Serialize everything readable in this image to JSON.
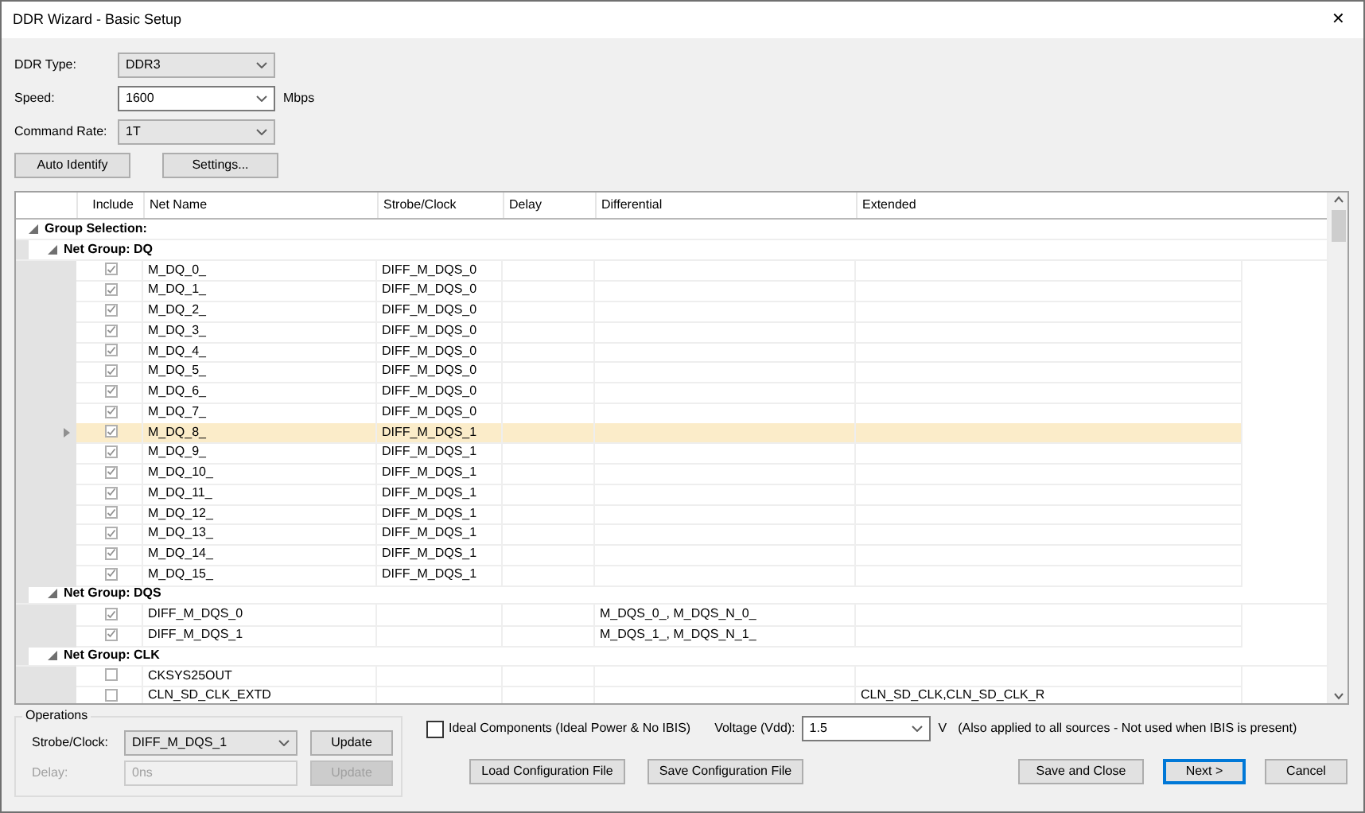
{
  "window": {
    "title": "DDR Wizard - Basic Setup",
    "close": "✕"
  },
  "fields": [
    {
      "label": "DDR Type:",
      "value": "DDR3",
      "editable": false
    },
    {
      "label": "Speed:",
      "value": "1600",
      "unit": "Mbps",
      "editable": true
    },
    {
      "label": "Command Rate:",
      "value": "1T",
      "editable": false
    }
  ],
  "buttons": [
    "Auto Identify",
    "Settings..."
  ],
  "grid": {
    "columns": [
      "Include",
      "Net Name",
      "Strobe/Clock",
      "Delay",
      "Differential",
      "Extended"
    ],
    "root": {
      "label": "Group Selection:",
      "expanded": true,
      "children": [
        {
          "label": "Net Group: DQ",
          "expanded": true,
          "rows": [
            {
              "include": true,
              "net": "M_DQ_0_",
              "strobe": "DIFF_M_DQS_0",
              "selected": false
            },
            {
              "include": true,
              "net": "M_DQ_1_",
              "strobe": "DIFF_M_DQS_0",
              "selected": false
            },
            {
              "include": true,
              "net": "M_DQ_2_",
              "strobe": "DIFF_M_DQS_0",
              "selected": false
            },
            {
              "include": true,
              "net": "M_DQ_3_",
              "strobe": "DIFF_M_DQS_0",
              "selected": false
            },
            {
              "include": true,
              "net": "M_DQ_4_",
              "strobe": "DIFF_M_DQS_0",
              "selected": false
            },
            {
              "include": true,
              "net": "M_DQ_5_",
              "strobe": "DIFF_M_DQS_0",
              "selected": false
            },
            {
              "include": true,
              "net": "M_DQ_6_",
              "strobe": "DIFF_M_DQS_0",
              "selected": false
            },
            {
              "include": true,
              "net": "M_DQ_7_",
              "strobe": "DIFF_M_DQS_0",
              "selected": false
            },
            {
              "include": true,
              "net": "M_DQ_8_",
              "strobe": "DIFF_M_DQS_1",
              "selected": true
            },
            {
              "include": true,
              "net": "M_DQ_9_",
              "strobe": "DIFF_M_DQS_1",
              "selected": false
            },
            {
              "include": true,
              "net": "M_DQ_10_",
              "strobe": "DIFF_M_DQS_1",
              "selected": false
            },
            {
              "include": true,
              "net": "M_DQ_11_",
              "strobe": "DIFF_M_DQS_1",
              "selected": false
            },
            {
              "include": true,
              "net": "M_DQ_12_",
              "strobe": "DIFF_M_DQS_1",
              "selected": false
            },
            {
              "include": true,
              "net": "M_DQ_13_",
              "strobe": "DIFF_M_DQS_1",
              "selected": false
            },
            {
              "include": true,
              "net": "M_DQ_14_",
              "strobe": "DIFF_M_DQS_1",
              "selected": false
            },
            {
              "include": true,
              "net": "M_DQ_15_",
              "strobe": "DIFF_M_DQS_1",
              "selected": false
            }
          ]
        },
        {
          "label": "Net Group: DQS",
          "expanded": true,
          "rows": [
            {
              "include": true,
              "net": "DIFF_M_DQS_0",
              "differential": "M_DQS_0_, M_DQS_N_0_",
              "selected": false
            },
            {
              "include": true,
              "net": "DIFF_M_DQS_1",
              "differential": "M_DQS_1_, M_DQS_N_1_",
              "selected": false
            }
          ]
        },
        {
          "label": "Net Group: CLK",
          "expanded": true,
          "rows": [
            {
              "include": false,
              "net": "CKSYS25OUT",
              "selected": false
            },
            {
              "include": false,
              "net": "CLN_SD_CLK_EXTD",
              "extended": "CLN_SD_CLK,CLN_SD_CLK_R",
              "selected": false
            }
          ]
        }
      ]
    }
  },
  "operations": {
    "title": "Operations",
    "rows": [
      {
        "label": "Strobe/Clock:",
        "value": "DIFF_M_DQS_1",
        "button": "Update",
        "disabled": false
      },
      {
        "label": "Delay:",
        "value": "0ns",
        "button": "Update",
        "disabled": true
      }
    ]
  },
  "ideal": {
    "label": "Ideal Components (Ideal Power & No IBIS)",
    "checked": false
  },
  "voltage": {
    "label": "Voltage (Vdd):",
    "value": "1.5",
    "unit": "V",
    "note": "(Also applied to all sources - Not used when IBIS is present)"
  },
  "file_buttons": [
    "Load Configuration File",
    "Save Configuration File"
  ],
  "dialog_buttons": [
    {
      "label": "Save and Close",
      "default": false
    },
    {
      "label": "Next >",
      "default": true
    },
    {
      "label": "Cancel",
      "default": false
    }
  ]
}
